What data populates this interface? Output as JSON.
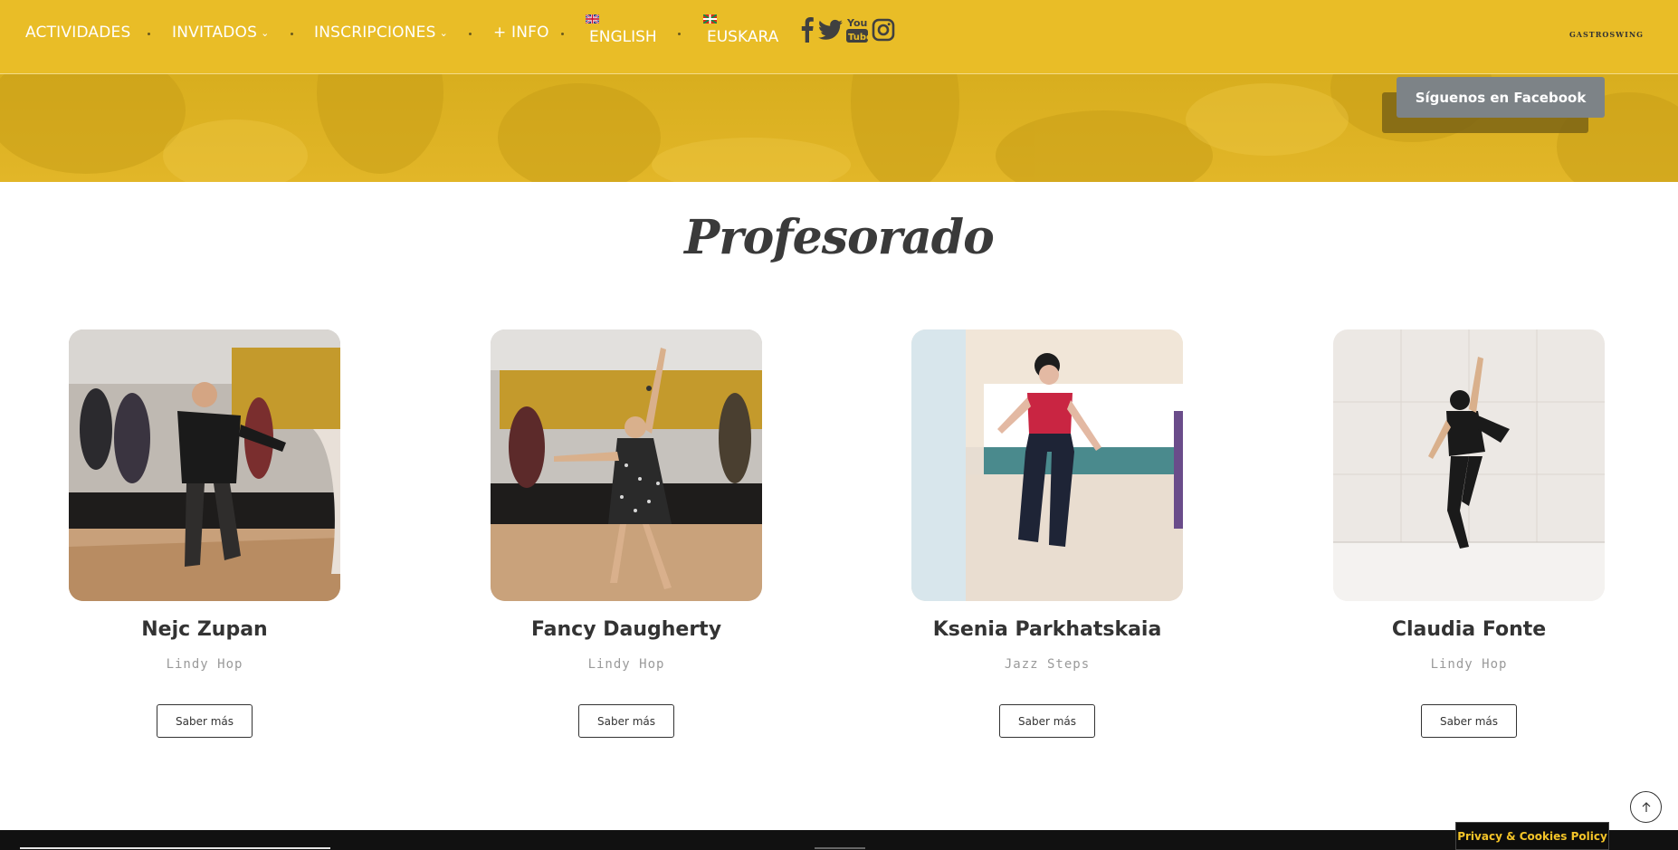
{
  "nav": {
    "items": [
      {
        "label": "ACTIVIDADES",
        "has_dropdown": false
      },
      {
        "label": "INVITADOS",
        "has_dropdown": true
      },
      {
        "label": "INSCRIPCIONES",
        "has_dropdown": true
      },
      {
        "label": "+ INFO",
        "has_dropdown": false
      }
    ],
    "languages": [
      {
        "label": "ENGLISH",
        "flag": "uk-flag-icon"
      },
      {
        "label": "EUSKARA",
        "flag": "basque-flag-icon"
      }
    ],
    "social": [
      "facebook-icon",
      "twitter-icon",
      "youtube-icon",
      "instagram-icon"
    ],
    "brand": "GASTROSWING",
    "background": "#e9bd27"
  },
  "hero": {
    "facebook_button": "Síguenos en Facebook"
  },
  "section": {
    "title": "Profesorado"
  },
  "teachers": [
    {
      "name": "Nejc Zupan",
      "style": "Lindy Hop",
      "button": "Saber más"
    },
    {
      "name": "Fancy Daugherty",
      "style": "Lindy Hop",
      "button": "Saber más"
    },
    {
      "name": "Ksenia Parkhatskaia",
      "style": "Jazz Steps",
      "button": "Saber más"
    },
    {
      "name": "Claudia Fonte",
      "style": "Lindy Hop",
      "button": "Saber más"
    }
  ],
  "footer": {
    "cookie_label": "Privacy & Cookies Policy",
    "scroll_top_icon": "arrow-up-icon"
  },
  "colors": {
    "accent": "#e9bd27",
    "text_dark": "#333333",
    "muted": "#9a9a9a"
  }
}
